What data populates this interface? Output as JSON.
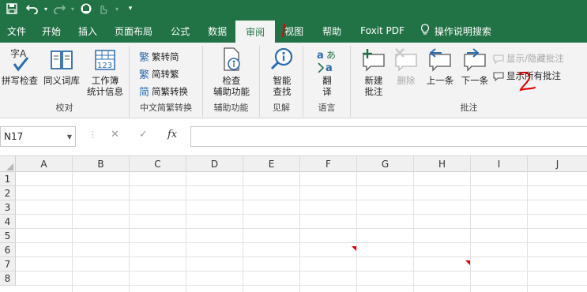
{
  "quick_access": {
    "save_icon": "save-icon",
    "undo_icon": "undo-icon",
    "redo_icon": "redo-icon",
    "touch_icon": "touch-mode-icon",
    "customize_icon": "customize-qat-icon"
  },
  "tabs": [
    {
      "label": "文件"
    },
    {
      "label": "开始"
    },
    {
      "label": "插入"
    },
    {
      "label": "页面布局"
    },
    {
      "label": "公式"
    },
    {
      "label": "数据"
    },
    {
      "label": "审阅",
      "active": true
    },
    {
      "label": "视图"
    },
    {
      "label": "帮助"
    },
    {
      "label": "Foxit PDF"
    },
    {
      "label": "操作说明搜索"
    }
  ],
  "ribbon": {
    "proofing": {
      "spelling": "拼写检查",
      "thesaurus": "同义词库",
      "workbook_stats_line1": "工作簿",
      "workbook_stats_line2": "统计信息",
      "label": "校对"
    },
    "chinese_conversion": {
      "to_traditional": "繁转简",
      "to_simplified": "简转繁",
      "convert": "简繁转换",
      "label": "中文简繁转换"
    },
    "accessibility": {
      "check_line1": "检查",
      "check_line2": "辅助功能",
      "label": "辅助功能"
    },
    "insights": {
      "smart_lookup_line1": "智能",
      "smart_lookup_line2": "查找",
      "label": "见解"
    },
    "language": {
      "translate_line1": "翻",
      "translate_line2": "译",
      "label": "语言"
    },
    "comments": {
      "new_line1": "新建",
      "new_line2": "批注",
      "delete": "删除",
      "previous": "上一条",
      "next": "下一条",
      "show_hide": "显示/隐藏批注",
      "show_all": "显示所有批注",
      "label": "批注"
    }
  },
  "formula_bar": {
    "name_box": "N17",
    "cancel_symbol": "✕",
    "enter_symbol": "✓",
    "fx_label": "fx",
    "value": ""
  },
  "grid": {
    "columns": [
      "A",
      "B",
      "C",
      "D",
      "E",
      "F",
      "G",
      "H",
      "I",
      "J"
    ],
    "rows": [
      "1",
      "2",
      "3",
      "4",
      "5",
      "6",
      "7",
      "8"
    ],
    "comment_cells": [
      "F6",
      "H7"
    ]
  },
  "colors": {
    "excel_green": "#217346",
    "ribbon_bg": "#f3f3f3",
    "comment_indicator": "#e00000",
    "annotation_red": "#e00000"
  }
}
